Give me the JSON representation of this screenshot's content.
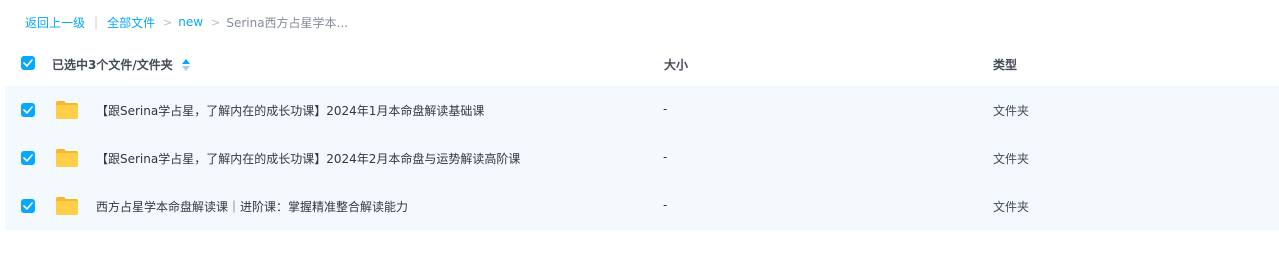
{
  "breadcrumb": {
    "back_label": "返回上一级",
    "separator": "|",
    "items": [
      {
        "label": "全部文件"
      },
      {
        "label": "new"
      },
      {
        "label": "Serina西方占星学本..."
      }
    ],
    "chevron": ">"
  },
  "table": {
    "header": {
      "selection_label": "已选中3个文件/文件夹",
      "size_label": "大小",
      "type_label": "类型"
    },
    "rows": [
      {
        "name": "【跟Serina学占星，了解内在的成长功课】2024年1月本命盘解读基础课",
        "size": "-",
        "type": "文件夹",
        "checked": true
      },
      {
        "name": "【跟Serina学占星，了解内在的成长功课】2024年2月本命盘与运势解读高阶课",
        "size": "-",
        "type": "文件夹",
        "checked": true
      },
      {
        "name": "西方占星学本命盘解读课｜进阶课：掌握精准整合解读能力",
        "size": "-",
        "type": "文件夹",
        "checked": true
      }
    ]
  },
  "colors": {
    "accent": "#06a7ff",
    "row_selected_bg": "#f3f9fc",
    "folder": "#ffc93c"
  },
  "icons": {
    "checkbox": "checkmark-icon",
    "sort": "sort-icon",
    "folder": "folder-icon",
    "chevron": "chevron-right-icon"
  }
}
